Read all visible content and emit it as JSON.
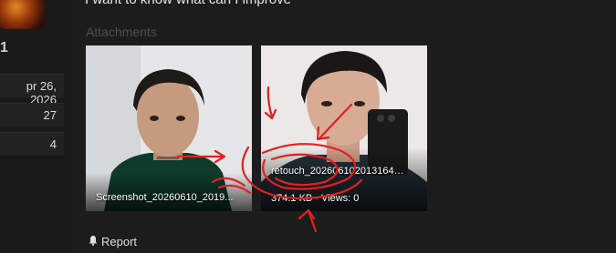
{
  "sidebar": {
    "number": "1",
    "stats": [
      {
        "value": "pr 26, 2026"
      },
      {
        "value": "27"
      },
      {
        "value": "4"
      }
    ]
  },
  "post": {
    "text": "I want to know what can I improve"
  },
  "attachments": {
    "label": "Attachments",
    "items": [
      {
        "filename": "Screenshot_20260610_2019...",
        "meta": ""
      },
      {
        "filename": "retouch_202606102013164…",
        "meta": "374.1 KB · Views: 0"
      }
    ]
  },
  "report": {
    "label": "Report",
    "icon": "bell-icon"
  },
  "annotation_color": "#e02020"
}
